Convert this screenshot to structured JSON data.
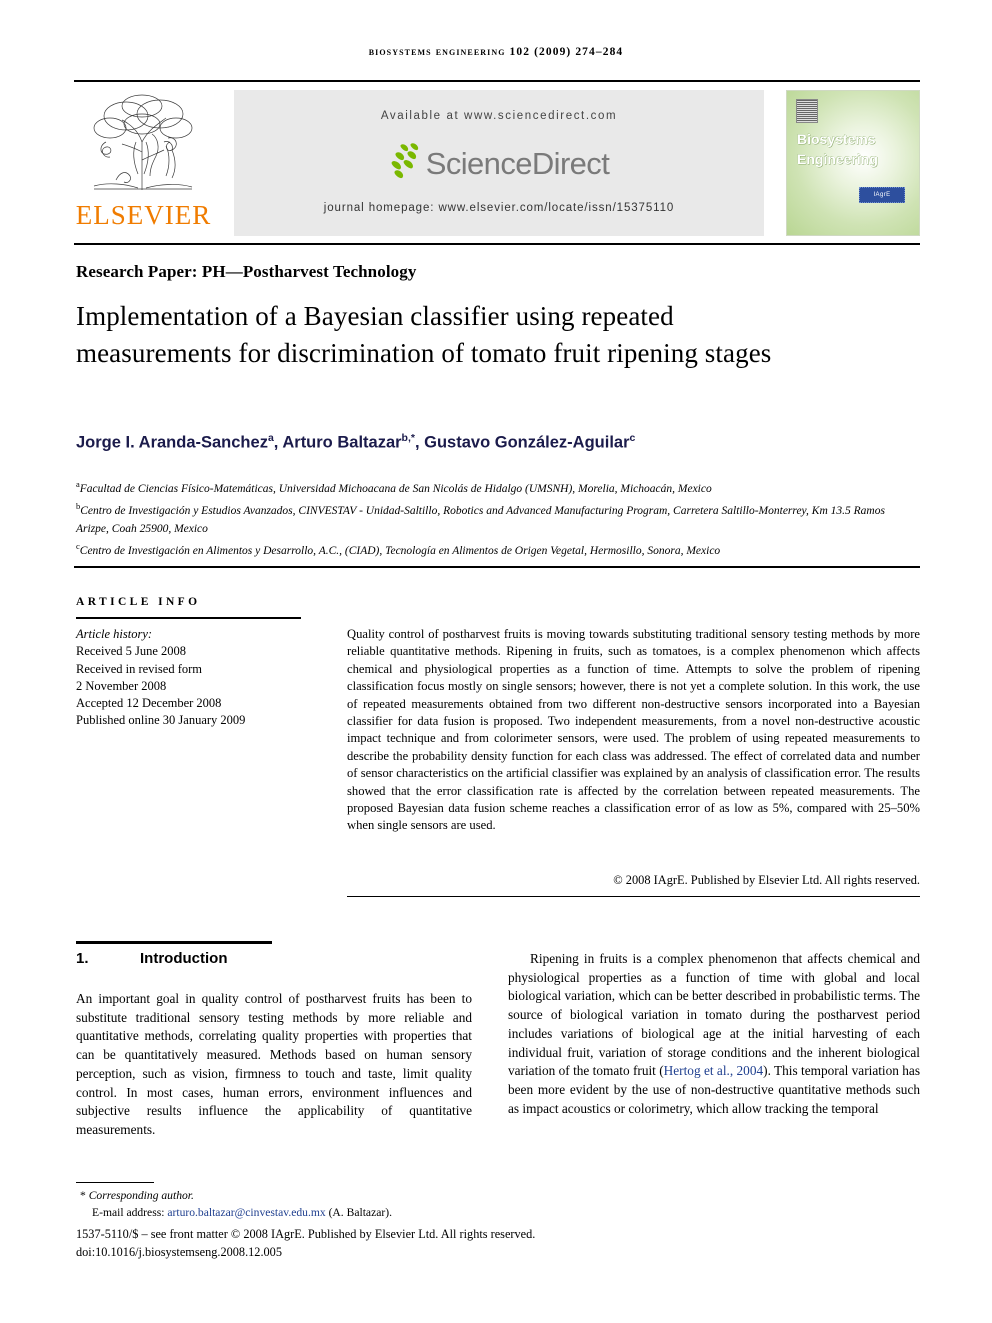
{
  "running_head": "Biosystems Engineering 102 (2009) 274–284",
  "masthead": {
    "publisher_name": "ELSEVIER",
    "available_at": "Available at www.sciencedirect.com",
    "sciencedirect_wordmark": "ScienceDirect",
    "journal_homepage": "journal homepage: www.elsevier.com/locate/issn/15375110",
    "cover_title": "Biosystems Engineering",
    "cover_badge": "IAgrE",
    "accent_orange": "#F07C00",
    "accent_green": "#7AB800",
    "band_grey": "#E9E9E9"
  },
  "article": {
    "kicker": "Research Paper: PH—Postharvest Technology",
    "title": "Implementation of a Bayesian classifier using repeated measurements for discrimination of tomato fruit ripening stages",
    "authors_html": "Jorge I. Aranda-Sanchez<sup>a</sup>, Arturo Baltazar<sup>b,*</sup>, Gustavo González-Aguilar<sup>c</sup>",
    "authors_plain": "Jorge I. Aranda-Sanchez a, Arturo Baltazar b,*, Gustavo González-Aguilar c",
    "affiliations": [
      "Facultad de Ciencias Físico-Matemáticas, Universidad Michoacana de San Nicolás de Hidalgo (UMSNH), Morelia, Michoacán, Mexico",
      "Centro de Investigación y Estudios Avanzados, CINVESTAV - Unidad-Saltillo, Robotics and Advanced Manufacturing Program, Carretera Saltillo-Monterrey, Km 13.5 Ramos Arizpe, Coah 25900, Mexico",
      "Centro de Investigación en Alimentos y Desarrollo, A.C., (CIAD), Tecnología en Alimentos de Origen Vegetal, Hermosillo, Sonora, Mexico"
    ],
    "affiliation_markers": [
      "a",
      "b",
      "c"
    ]
  },
  "article_info": {
    "heading": "ARTICLE INFO",
    "history_label": "Article history:",
    "history": [
      "Received 5 June 2008",
      "Received in revised form",
      "2 November 2008",
      "Accepted 12 December 2008",
      "Published online 30 January 2009"
    ]
  },
  "abstract": {
    "text": "Quality control of postharvest fruits is moving towards substituting traditional sensory testing methods by more reliable quantitative methods. Ripening in fruits, such as tomatoes, is a complex phenomenon which affects chemical and physiological properties as a function of time. Attempts to solve the problem of ripening classification focus mostly on single sensors; however, there is not yet a complete solution. In this work, the use of repeated measurements obtained from two different non-destructive sensors incorporated into a Bayesian classifier for data fusion is proposed. Two independent measurements, from a novel non-destructive acoustic impact technique and from colorimeter sensors, were used. The problem of using repeated measurements to describe the probability density function for each class was addressed. The effect of correlated data and number of sensor characteristics on the artificial classifier was explained by an analysis of classification error. The results showed that the error classification rate is affected by the correlation between repeated measurements. The proposed Bayesian data fusion scheme reaches a classification error of as low as 5%, compared with 25–50% when single sensors are used.",
    "copyright": "© 2008 IAgrE. Published by Elsevier Ltd. All rights reserved."
  },
  "body": {
    "section_number": "1.",
    "section_title": "Introduction",
    "left_paragraph": "An important goal in quality control of postharvest fruits has been to substitute traditional sensory testing methods by more reliable and quantitative methods, correlating quality properties with properties that can be quantitatively measured. Methods based on human sensory perception, such as vision, firmness to touch and taste, limit quality control. In most cases, human errors, environment influences and subjective results influence the applicability of quantitative measurements.",
    "right_paragraph_before_cite": "Ripening in fruits is a complex phenomenon that affects chemical and physiological properties as a function of time with global and local biological variation, which can be better described in probabilistic terms. The source of biological variation in tomato during the postharvest period includes variations of biological age at the initial harvesting of each individual fruit, variation of storage conditions and the inherent biological variation of the tomato fruit (",
    "right_paragraph_citation": "Hertog et al., 2004",
    "right_paragraph_after_cite": "). This temporal variation has been more evident by the use of non-destructive quantitative methods such as impact acoustics or colorimetry, which allow tracking the temporal"
  },
  "footer": {
    "corresponding_marker": "*",
    "corresponding_author": "Corresponding author.",
    "email_label": "E-mail address:",
    "email": "arturo.baltazar@cinvestav.edu.mx",
    "email_owner": "(A. Baltazar).",
    "issn_line": "1537-5110/$ – see front matter © 2008 IAgrE. Published by Elsevier Ltd. All rights reserved.",
    "doi_line": "doi:10.1016/j.biosystemseng.2008.12.005",
    "link_color": "#1F3F8F"
  }
}
